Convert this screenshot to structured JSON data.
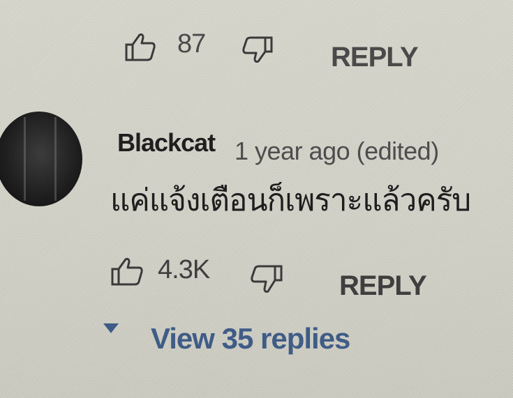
{
  "previous_comment": {
    "like_count": "87",
    "reply_label": "REPLY"
  },
  "comment": {
    "author": "Blackcat",
    "timestamp": "1 year ago (edited)",
    "text": "แค่แจ้งเตือนก็เพราะแล้วครับ",
    "like_count": "4.3K",
    "reply_label": "REPLY",
    "view_replies_label": "View 35 replies"
  },
  "icons": {
    "like": "thumbs-up-icon",
    "dislike": "thumbs-down-icon",
    "expand": "caret-down-icon"
  },
  "colors": {
    "link_blue": "#3f5c86",
    "text_dark": "#1e1e1e",
    "text_muted": "#4d4d4d"
  }
}
